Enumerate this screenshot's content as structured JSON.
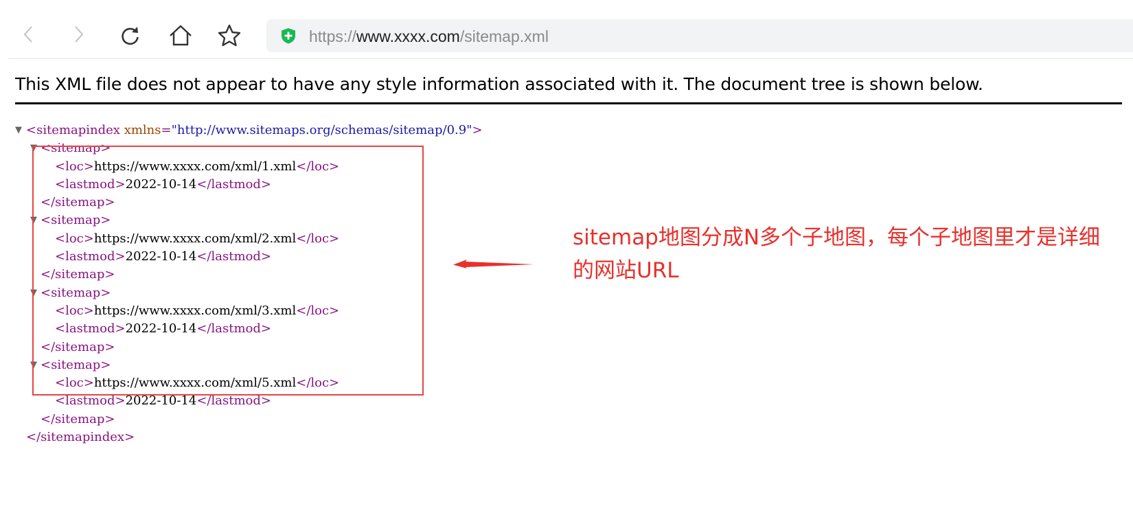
{
  "browser": {
    "url_scheme": "https://",
    "url_host": "www.xxxx.com",
    "url_path": "/sitemap.xml"
  },
  "banner": {
    "text": "This XML file does not appear to have any style information associated with it. The document tree is shown below."
  },
  "xml": {
    "root_open_tag": "<sitemapindex",
    "root_attr_name": "xmlns",
    "root_attr_value": "\"http://www.sitemaps.org/schemas/sitemap/0.9\"",
    "root_open_end": ">",
    "root_close": "</sitemapindex>",
    "sitemaps": [
      {
        "open": "<sitemap>",
        "loc_open": "<loc>",
        "loc": "https://www.xxxx.com/xml/1.xml",
        "loc_close": "</loc>",
        "lastmod_open": "<lastmod>",
        "lastmod": "2022-10-14",
        "lastmod_close": "</lastmod>",
        "close": "</sitemap>"
      },
      {
        "open": "<sitemap>",
        "loc_open": "<loc>",
        "loc": "https://www.xxxx.com/xml/2.xml",
        "loc_close": "</loc>",
        "lastmod_open": "<lastmod>",
        "lastmod": "2022-10-14",
        "lastmod_close": "</lastmod>",
        "close": "</sitemap>"
      },
      {
        "open": "<sitemap>",
        "loc_open": "<loc>",
        "loc": "https://www.xxxx.com/xml/3.xml",
        "loc_close": "</loc>",
        "lastmod_open": "<lastmod>",
        "lastmod": "2022-10-14",
        "lastmod_close": "</lastmod>",
        "close": "</sitemap>"
      },
      {
        "open": "<sitemap>",
        "loc_open": "<loc>",
        "loc": "https://www.xxxx.com/xml/5.xml",
        "loc_close": "</loc>",
        "lastmod_open": "<lastmod>",
        "lastmod": "2022-10-14",
        "lastmod_close": "</lastmod>",
        "close": "</sitemap>"
      }
    ]
  },
  "annotation": {
    "note": "sitemap地图分成N多个子地图，每个子地图里才是详细的网站URL",
    "color": "#e8302c"
  },
  "icons": {
    "back": "back-arrow-icon",
    "forward": "forward-arrow-icon",
    "reload": "reload-icon",
    "home": "home-icon",
    "bookmark": "star-icon",
    "security": "shield-icon",
    "collapse": "collapse-triangle-icon"
  },
  "colors": {
    "tag": "#881280",
    "attr_name": "#994500",
    "attr_value": "#1a1aa6",
    "shield": "#19b955"
  }
}
